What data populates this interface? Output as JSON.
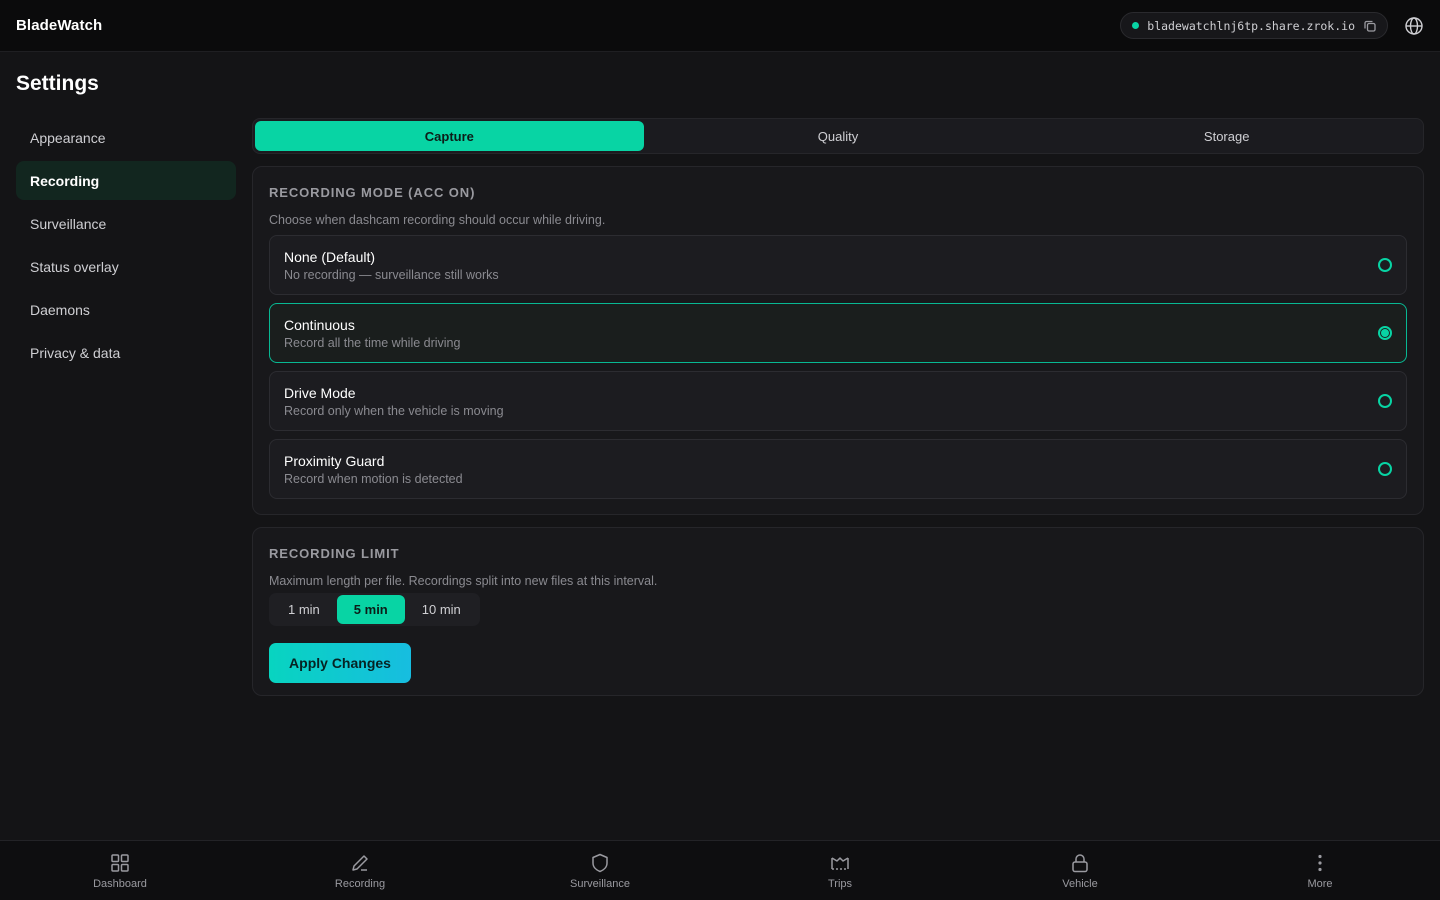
{
  "app": {
    "title": "BladeWatch"
  },
  "header": {
    "share_url": "bladewatchlnj6tp.share.zrok.io",
    "status_color": "#08d4a4"
  },
  "page": {
    "title": "Settings"
  },
  "sidebar": {
    "items": [
      {
        "label": "Appearance"
      },
      {
        "label": "Recording",
        "active": true
      },
      {
        "label": "Surveillance"
      },
      {
        "label": "Status overlay"
      },
      {
        "label": "Daemons"
      },
      {
        "label": "Privacy & data"
      }
    ]
  },
  "tabs": [
    {
      "label": "Capture",
      "active": true
    },
    {
      "label": "Quality"
    },
    {
      "label": "Storage"
    }
  ],
  "recording_mode": {
    "title": "RECORDING MODE (ACC ON)",
    "description": "Choose when dashcam recording should occur while driving.",
    "options": [
      {
        "title": "None (Default)",
        "subtitle": "No recording — surveillance still works",
        "selected": false
      },
      {
        "title": "Continuous",
        "subtitle": "Record all the time while driving",
        "selected": true
      },
      {
        "title": "Drive Mode",
        "subtitle": "Record only when the vehicle is moving",
        "selected": false
      },
      {
        "title": "Proximity Guard",
        "subtitle": "Record when motion is detected",
        "selected": false
      }
    ]
  },
  "recording_limit": {
    "title": "RECORDING LIMIT",
    "description": "Maximum length per file. Recordings split into new files at this interval.",
    "options": [
      {
        "label": "1 min"
      },
      {
        "label": "5 min",
        "active": true
      },
      {
        "label": "10 min"
      }
    ],
    "apply_label": "Apply Changes"
  },
  "bottom_nav": {
    "items": [
      {
        "label": "Dashboard",
        "icon": "grid-icon"
      },
      {
        "label": "Recording",
        "icon": "pencil-icon"
      },
      {
        "label": "Surveillance",
        "icon": "shield-icon"
      },
      {
        "label": "Trips",
        "icon": "route-icon"
      },
      {
        "label": "Vehicle",
        "icon": "lock-icon"
      },
      {
        "label": "More",
        "icon": "more-vertical-icon"
      }
    ]
  },
  "colors": {
    "accent": "#08d4a4",
    "background": "#141416"
  }
}
